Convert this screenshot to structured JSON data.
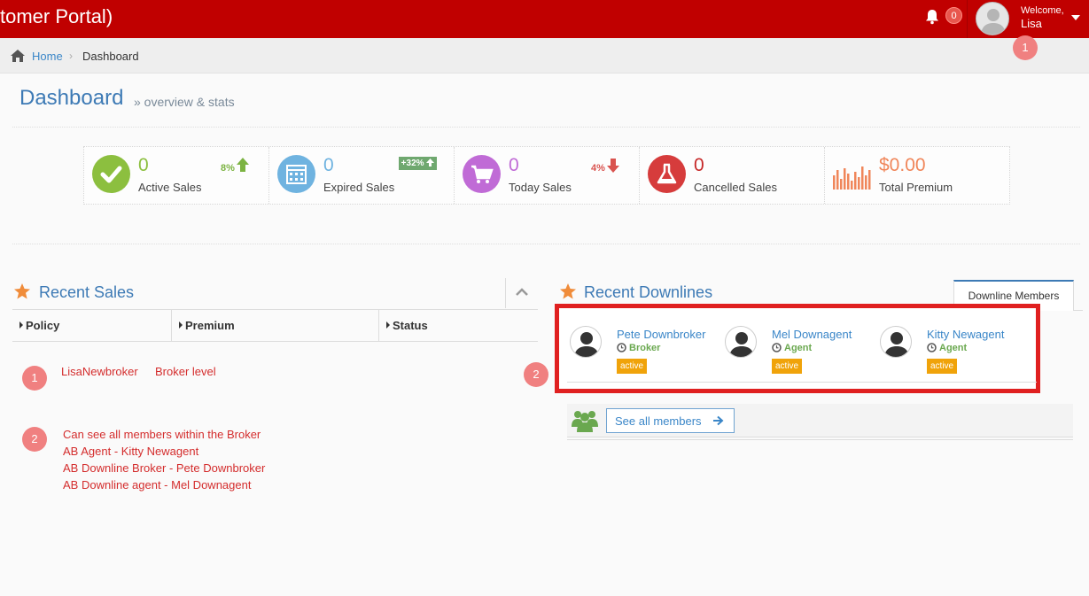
{
  "header": {
    "brand": "tomer Portal)",
    "notification_count": "0",
    "welcome": "Welcome,",
    "username": "Lisa",
    "annotation": "1"
  },
  "breadcrumb": {
    "home": "Home",
    "current": "Dashboard"
  },
  "page": {
    "title": "Dashboard",
    "subtitle": "» overview & stats"
  },
  "stats": [
    {
      "value": "0",
      "label": "Active Sales",
      "change": "8%",
      "color": "#8cbf3f",
      "num_color": "#8cbf3f"
    },
    {
      "value": "0",
      "label": "Expired Sales",
      "change": "+32%",
      "color": "#6fb3e0",
      "num_color": "#6fb3e0"
    },
    {
      "value": "0",
      "label": "Today Sales",
      "change": "4%",
      "color": "#c06bd6",
      "num_color": "#c06bd6"
    },
    {
      "value": "0",
      "label": "Cancelled Sales",
      "change": "",
      "color": "#d63c3c",
      "num_color": "#c62828"
    },
    {
      "value": "$0.00",
      "label": "Total Premium",
      "change": "",
      "color": "#f0865a",
      "num_color": "#f0865a"
    }
  ],
  "recent_sales": {
    "title": "Recent Sales",
    "columns": [
      "Policy",
      "Premium",
      "Status"
    ],
    "badge_1": "1",
    "badge_2": "2",
    "note_1a": "LisaNewbroker",
    "note_1b": "Broker level",
    "note_2_lines": [
      "Can see all members within the Broker",
      "AB Agent - Kitty Newagent",
      "AB Downline Broker - Pete Downbroker",
      "AB Downline agent - Mel Downagent"
    ]
  },
  "recent_downlines": {
    "title": "Recent Downlines",
    "tab": "Downline Members",
    "members": [
      {
        "name": "Pete Downbroker",
        "role": "Broker",
        "status": "active"
      },
      {
        "name": "Mel Downagent",
        "role": "Agent",
        "status": "active"
      },
      {
        "name": "Kitty Newagent",
        "role": "Agent",
        "status": "active"
      }
    ],
    "see_all": "See all members"
  },
  "colors": {
    "header": "#c00000",
    "link": "#3a86c8",
    "highlight_border": "#e02020",
    "annotation_text": "#d42d2d"
  }
}
